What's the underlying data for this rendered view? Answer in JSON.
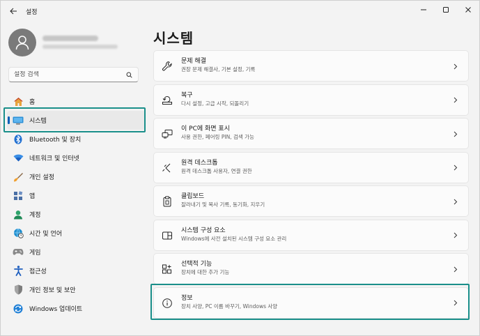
{
  "window": {
    "title": "설정",
    "back_icon": "back-arrow-icon",
    "controls": {
      "minimize": "─",
      "maximize": "☐",
      "close": "✕"
    }
  },
  "sidebar": {
    "search": {
      "placeholder": "설정 검색",
      "value": ""
    },
    "items": [
      {
        "label": "홈",
        "icon": "home-icon",
        "active": false
      },
      {
        "label": "시스템",
        "icon": "monitor-icon",
        "active": true
      },
      {
        "label": "Bluetooth 및 장치",
        "icon": "bluetooth-icon",
        "active": false
      },
      {
        "label": "네트워크 및 인터넷",
        "icon": "wifi-icon",
        "active": false
      },
      {
        "label": "개인 설정",
        "icon": "brush-icon",
        "active": false
      },
      {
        "label": "앱",
        "icon": "apps-icon",
        "active": false
      },
      {
        "label": "계정",
        "icon": "account-icon",
        "active": false
      },
      {
        "label": "시간 및 언어",
        "icon": "globe-clock-icon",
        "active": false
      },
      {
        "label": "게임",
        "icon": "gamepad-icon",
        "active": false
      },
      {
        "label": "접근성",
        "icon": "accessibility-icon",
        "active": false
      },
      {
        "label": "개인 정보 및 보안",
        "icon": "shield-icon",
        "active": false
      },
      {
        "label": "Windows 업데이트",
        "icon": "update-icon",
        "active": false
      }
    ]
  },
  "main": {
    "title": "시스템",
    "cards": [
      {
        "title": "문제 해결",
        "subtitle": "권장 문제 해결사, 기본 설정, 기록",
        "icon": "wrench-icon"
      },
      {
        "title": "복구",
        "subtitle": "다시 설정, 고급 시작, 되돌리기",
        "icon": "recovery-icon"
      },
      {
        "title": "이 PC에 화면 표시",
        "subtitle": "사용 권한, 페어링 PIN, 검색 가능",
        "icon": "project-icon"
      },
      {
        "title": "원격 데스크톱",
        "subtitle": "원격 데스크톱 사용자, 연결 권한",
        "icon": "remote-desktop-icon"
      },
      {
        "title": "클립보드",
        "subtitle": "잘라내기 및 복사 기록, 동기화, 지우기",
        "icon": "clipboard-icon"
      },
      {
        "title": "시스템 구성 요소",
        "subtitle": "Windows에 사전 설치된 시스템 구성 요소 관리",
        "icon": "components-icon"
      },
      {
        "title": "선택적 기능",
        "subtitle": "장치에 대한 추가 기능",
        "icon": "optional-features-icon"
      },
      {
        "title": "정보",
        "subtitle": "장치 사양, PC 이름 바꾸기, Windows 사양",
        "icon": "info-icon"
      }
    ]
  },
  "colors": {
    "accent": "#005fb8",
    "highlight": "#1a8f8a"
  }
}
